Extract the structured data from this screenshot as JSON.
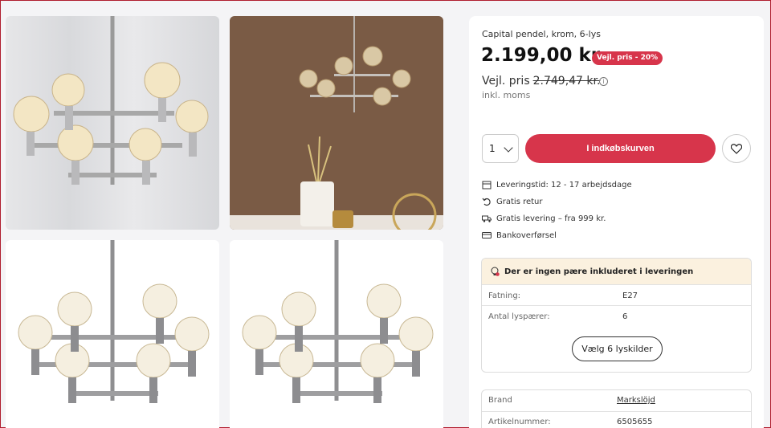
{
  "product": {
    "title": "Capital pendel, krom, 6-lys",
    "price": "2.199,00 kr.",
    "badge": "Vejl. pris - 20%",
    "rrp_label": "Vejl. pris",
    "rrp_value": "2.749,47 kr.",
    "vat_note": "inkl. moms"
  },
  "purchase": {
    "quantity": "1",
    "cart_label": "I indkøbskurven"
  },
  "features": [
    {
      "icon": "calendar-icon",
      "text": "Leveringstid: 12 - 17 arbejdsdage"
    },
    {
      "icon": "return-icon",
      "text": "Gratis retur"
    },
    {
      "icon": "truck-icon",
      "text": "Gratis levering – fra 999 kr."
    },
    {
      "icon": "card-icon",
      "text": "Bankoverførsel"
    }
  ],
  "spec": {
    "notice": "Der er ingen pære inkluderet i leveringen",
    "rows": [
      {
        "key": "Fatning:",
        "value": "E27"
      },
      {
        "key": "Antal lyspærer:",
        "value": "6"
      }
    ],
    "button": "Vælg 6 lyskilder"
  },
  "details": [
    {
      "key": "Brand",
      "value": "Markslöjd"
    },
    {
      "key": "Artikelnummer:",
      "value": "6505655"
    }
  ],
  "colors": {
    "accent": "#d7354b",
    "notice_bg": "#fbf1df"
  }
}
